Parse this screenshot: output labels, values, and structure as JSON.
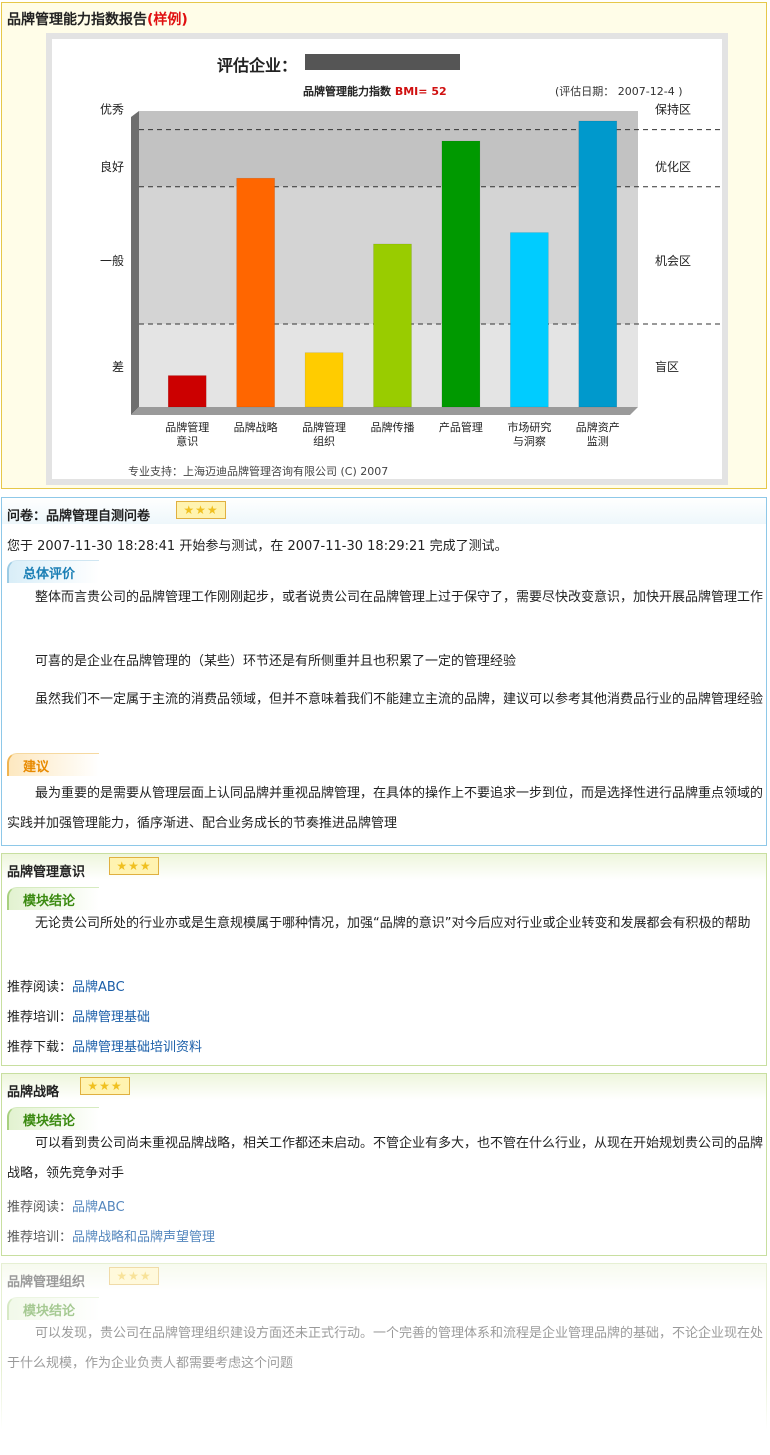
{
  "report": {
    "title": "品牌管理能力指数报告",
    "sample_tag": "(样例)",
    "company_label": "评估企业：",
    "bmi_label": "品牌管理能力指数",
    "bmi_value": "BMI= 52",
    "eval_date": "(评估日期：   2007-12-4 )",
    "support": "专业支持：上海迈迪品牌管理咨询有限公司  (C) 2007"
  },
  "chart_data": {
    "type": "bar",
    "categories": [
      "品牌管理\n意识",
      "品牌战略",
      "品牌管理\n组织",
      "品牌传播",
      "产品管理",
      "市场研究\n与洞察",
      "品牌资产\n监测"
    ],
    "values": [
      11,
      80,
      19,
      57,
      93,
      61,
      100
    ],
    "colors": [
      "#cc0000",
      "#ff6600",
      "#ffcc00",
      "#99cc00",
      "#009900",
      "#00ccff",
      "#0099cc"
    ],
    "ylim": [
      0,
      100
    ],
    "left_levels": [
      {
        "label": "优秀",
        "value": 104
      },
      {
        "label": "良好",
        "value": 84
      },
      {
        "label": "一般",
        "value": 51
      },
      {
        "label": "差",
        "value": 14
      }
    ],
    "right_zones": [
      {
        "label": "保持区",
        "value": 104
      },
      {
        "label": "优化区",
        "value": 84
      },
      {
        "label": "机会区",
        "value": 51
      },
      {
        "label": "盲区",
        "value": 14
      }
    ],
    "thresholds": [
      97,
      77,
      29
    ],
    "grid": "dashed-thresholds"
  },
  "questionnaire": {
    "title": "问卷：品牌管理自测问卷",
    "stars": "★★★",
    "summary_line": "您于  2007-11-30  18:28:41  开始参与测试，在  2007-11-30  18:29:21  完成了测试。",
    "overall_label": "总体评价",
    "overall_paras": [
      "整体而言贵公司的品牌管理工作刚刚起步，或者说贵公司在品牌管理上过于保守了，需要尽快改变意识，加快开展品牌管理工作",
      "可喜的是企业在品牌管理的（某些）环节还是有所侧重并且也积累了一定的管理经验",
      "虽然我们不一定属于主流的消费品领域，但并不意味着我们不能建立主流的品牌，建议可以参考其他消费品行业的品牌管理经验"
    ],
    "advice_label": "建议",
    "advice_para": "最为重要的是需要从管理层面上认同品牌并重视品牌管理，在具体的操作上不要追求一步到位，而是选择性进行品牌重点领域的实践并加强管理能力，循序渐进、配合业务成长的节奏推进品牌管理"
  },
  "modules": [
    {
      "title": "品牌管理意识",
      "stars": "★★★",
      "conclusion_label": "模块结论",
      "conclusion": "无论贵公司所处的行业亦或是生意规模属于哪种情况，加强“品牌的意识”对今后应对行业或企业转变和发展都会有积极的帮助",
      "reading_label": "推荐阅读：",
      "reading": "品牌ABC",
      "training_label": "推荐培训：",
      "training": "品牌管理基础",
      "download_label": "推荐下载：",
      "download": "品牌管理基础培训资料"
    },
    {
      "title": "品牌战略",
      "stars": "★★★",
      "conclusion_label": "模块结论",
      "conclusion": "可以看到贵公司尚未重视品牌战略，相关工作都还未启动。不管企业有多大，也不管在什么行业，从现在开始规划贵公司的品牌战略，领先竞争对手",
      "reading_label": "推荐阅读：",
      "reading": "品牌ABC",
      "training_label": "推荐培训：",
      "training": "品牌战略和品牌声望管理"
    },
    {
      "title": "品牌管理组织",
      "stars": "★★★",
      "conclusion_label": "模块结论",
      "conclusion": "可以发现，贵公司在品牌管理组织建设方面还未正式行动。一个完善的管理体系和流程是企业管理品牌的基础，不论企业现在处于什么规模，作为企业负责人都需要考虑这个问题"
    }
  ]
}
